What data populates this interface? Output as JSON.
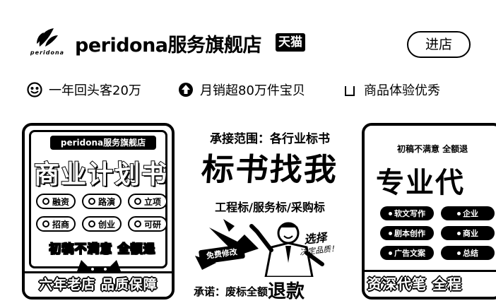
{
  "store": {
    "logo_text": "peridona",
    "name": "peridona服务旗舰店",
    "badge": "天猫",
    "enter_label": "进店"
  },
  "stats": [
    {
      "icon": "smile-icon",
      "text": "一年回头客20万"
    },
    {
      "icon": "up-arrow-icon",
      "text": "月销超80万件宝贝"
    },
    {
      "icon": "bag-icon",
      "text": "商品体验优秀"
    }
  ],
  "products": [
    {
      "shop": "peridona服务旗舰店",
      "title": "商业计划书",
      "tags_row1": [
        "融资",
        "路演",
        "立项"
      ],
      "tags_row2": [
        "招商",
        "创业",
        "可研"
      ],
      "guarantee": "初稿不满意 全额退",
      "footer": "六年老店 品质保障"
    },
    {
      "scope": "承接范围：各行业标书",
      "title": "标书找我",
      "types": "工程标/服务标/采购标",
      "free_badge": "免费修改",
      "choose": "选择",
      "decide": "决定品质！",
      "promise_prefix": "承诺：废标全额",
      "promise_big": "退款"
    },
    {
      "note": "初稿不满意 全额退",
      "title": "专业代",
      "tags": [
        "软文写作",
        "企业",
        "剧本创作",
        "商业",
        "广告文案",
        "总结"
      ],
      "footer": "资深代笔 全程"
    }
  ]
}
